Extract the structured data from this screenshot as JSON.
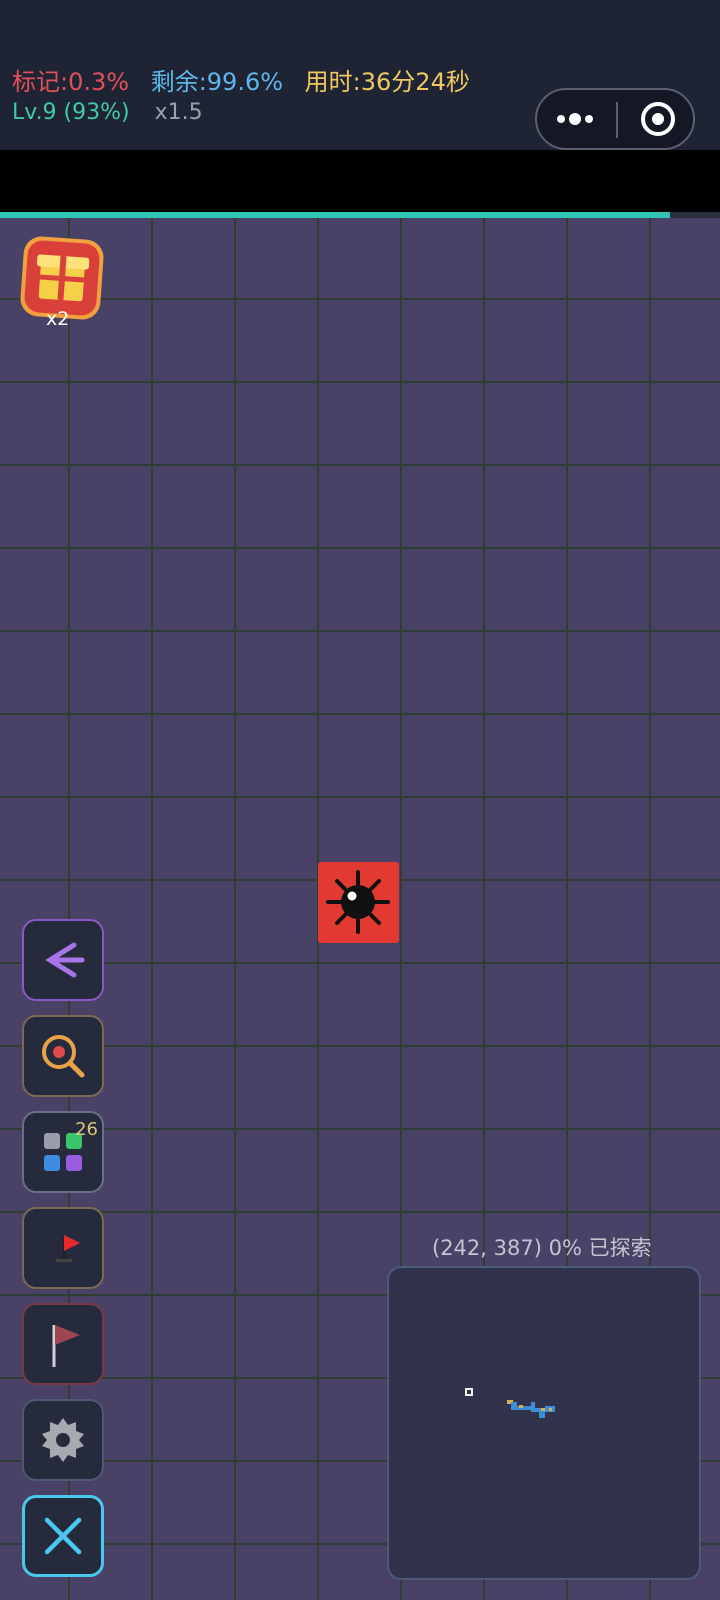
{
  "header": {
    "marked_label": "标记:0.3%",
    "remaining_label": "剩余:99.6%",
    "time_label": "用时:36分24秒",
    "level_label": "Lv.9 (93%)",
    "speed_label": "x1.5"
  },
  "progress": {
    "level_fraction": 0.93
  },
  "gift": {
    "count_label": "x2"
  },
  "sidebar": {
    "items": [
      {
        "name": "back",
        "icon": "back-arrow-icon"
      },
      {
        "name": "search",
        "icon": "search-icon"
      },
      {
        "name": "inventory",
        "icon": "grid-icon",
        "count": "26"
      },
      {
        "name": "flag-place",
        "icon": "red-flag-icon"
      },
      {
        "name": "flag-mode",
        "icon": "flag-icon"
      },
      {
        "name": "settings",
        "icon": "gear-icon"
      },
      {
        "name": "close",
        "icon": "close-icon"
      }
    ]
  },
  "minimap": {
    "coords_label": "(242, 387)  0% 已探索"
  },
  "colors": {
    "board": "#4a4166",
    "grid_line": "#2f3e33",
    "mine_cell": "#e23a32",
    "progress": "#2fc6b6",
    "marked": "#e0505a",
    "remaining": "#5fb6ea",
    "time": "#f0c862",
    "level": "#3fc9a8"
  }
}
